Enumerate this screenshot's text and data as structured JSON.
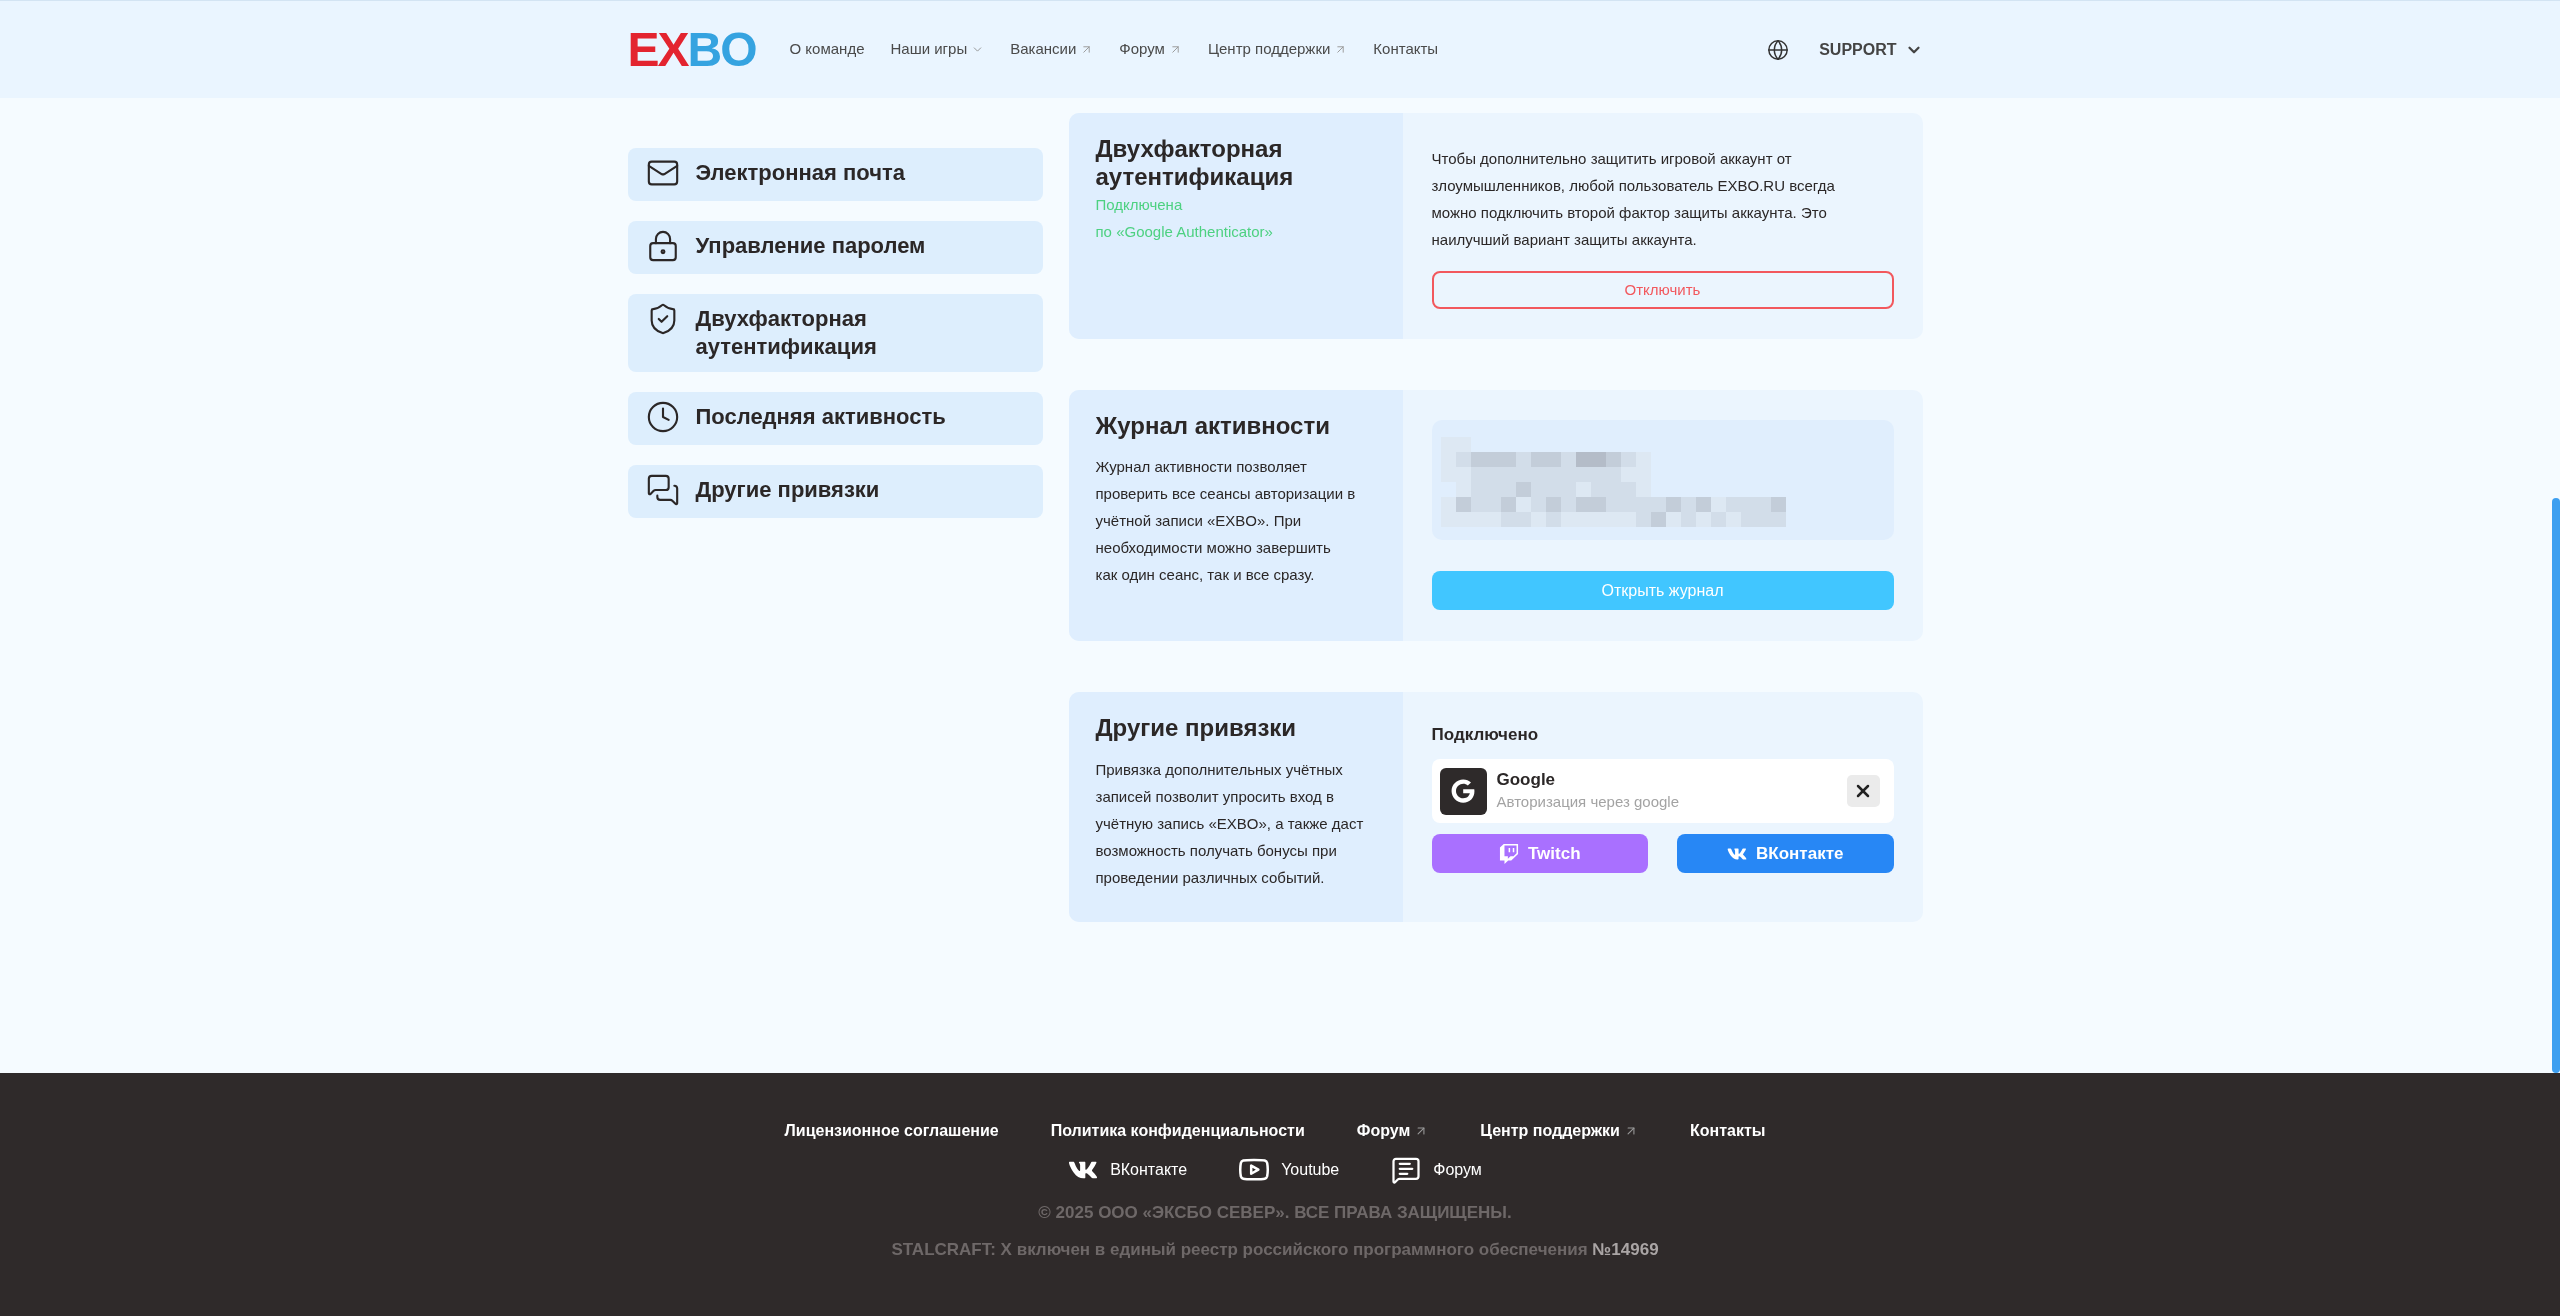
{
  "header": {
    "logo": "EXBO",
    "nav": [
      {
        "label": "О команде",
        "kind": "link"
      },
      {
        "label": "Наши игры",
        "kind": "dropdown"
      },
      {
        "label": "Вакансии",
        "kind": "external"
      },
      {
        "label": "Форум",
        "kind": "external"
      },
      {
        "label": "Центр поддержки",
        "kind": "external"
      },
      {
        "label": "Контакты",
        "kind": "link"
      }
    ],
    "account_menu": {
      "label": "SUPPORT"
    }
  },
  "sidebar": {
    "items": [
      {
        "label": "Электронная почта",
        "kind": "mail"
      },
      {
        "label": "Управление паролем",
        "kind": "lock"
      },
      {
        "label": "Двухфакторная аутентификация",
        "kind": "shield"
      },
      {
        "label": "Последняя активность",
        "kind": "clock"
      },
      {
        "label": "Другие привязки",
        "kind": "chat"
      }
    ]
  },
  "two_factor": {
    "title": "Двухфакторная аутентификация",
    "status": "Подключена",
    "method": "по «Google Authenticator»",
    "description": "Чтобы дополнительно защитить игровой аккаунт от злоумышленников, любой пользователь EXBO.RU всегда можно подключить второй фактор защиты аккаунта. Это наилучший вариант защиты аккаунта.",
    "disable_button": "Отключить"
  },
  "activity_log": {
    "title": "Журнал активности",
    "description": "Журнал активности позволяет проверить все сеансы авторизации в учётной записи «EXBO». При необходимости можно завершить как один сеанс, так и все сразу.",
    "open_button": "Открыть журнал"
  },
  "other_bindings": {
    "title": "Другие привязки",
    "description": "Привязка дополнительных учётных записей позволит упросить вход в учётную запись «EXBO», а также даст возможность получать бонусы при проведении различных событий.",
    "connected_label": "Подключено",
    "connected": [
      {
        "name": "Google",
        "note": "Авторизация через google",
        "kind": "google"
      }
    ],
    "available": [
      {
        "label": "Twitch",
        "kind": "twitch"
      },
      {
        "label": "ВКонтакте",
        "kind": "vk"
      }
    ]
  },
  "footer": {
    "links": [
      {
        "label": "Лицензионное соглашение",
        "kind": "link"
      },
      {
        "label": "Политика конфиденциальности",
        "kind": "link"
      },
      {
        "label": "Форум",
        "kind": "external"
      },
      {
        "label": "Центр поддержки",
        "kind": "external"
      },
      {
        "label": "Контакты",
        "kind": "link"
      }
    ],
    "social": [
      {
        "label": "ВКонтакте",
        "kind": "vk"
      },
      {
        "label": "Youtube",
        "kind": "youtube"
      },
      {
        "label": "Форум",
        "kind": "forum"
      }
    ],
    "copyright": "© 2025 ООО «ЭКСБО СЕВЕР». ВСЕ ПРАВА ЗАЩИЩЕНЫ.",
    "registry": {
      "text": "STALCRAFT: X включен в единый реестр российского программного обеспечения",
      "number": "№14969"
    }
  }
}
